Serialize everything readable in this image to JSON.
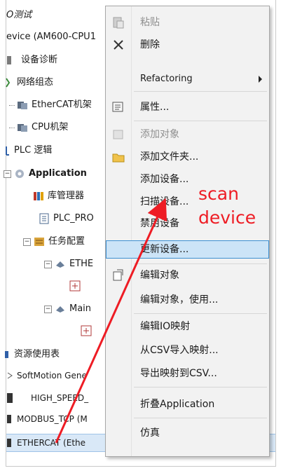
{
  "tree": {
    "root_title": "O测试",
    "device": "evice (AM600-CPU1",
    "items": [
      {
        "label": "设备诊断"
      },
      {
        "label": "网络组态"
      },
      {
        "label": "EtherCAT机架"
      },
      {
        "label": "CPU机架"
      },
      {
        "label": "PLC 逻辑"
      },
      {
        "label": "Application"
      },
      {
        "label": "库管理器"
      },
      {
        "label": "PLC_PRO"
      },
      {
        "label": "任务配置"
      },
      {
        "label": "ETHE"
      },
      {
        "label": "Main"
      },
      {
        "label": "资源使用表"
      },
      {
        "label": "SoftMotion Gene"
      },
      {
        "label": "HIGH_SPEED_"
      },
      {
        "label": "MODBUS_TCP (M"
      },
      {
        "label": "ETHERCAT (Ethe"
      }
    ]
  },
  "context_menu": {
    "items": [
      {
        "label": "粘贴",
        "icon": "paste-icon",
        "enabled": false
      },
      {
        "label": "删除",
        "icon": "delete-icon",
        "enabled": true
      },
      {
        "label": "Refactoring",
        "icon": "",
        "enabled": true,
        "submenu": true
      },
      {
        "label": "属性...",
        "icon": "properties-icon",
        "enabled": true
      },
      {
        "label": "添加对象",
        "icon": "add-object-icon",
        "enabled": false
      },
      {
        "label": "添加文件夹...",
        "icon": "folder-icon",
        "enabled": true
      },
      {
        "label": "添加设备...",
        "icon": "",
        "enabled": true
      },
      {
        "label": "扫描设备...",
        "icon": "",
        "enabled": true
      },
      {
        "label": "禁用设备",
        "icon": "",
        "enabled": true
      },
      {
        "label": "更新设备...",
        "icon": "",
        "enabled": true,
        "highlighted": true
      },
      {
        "label": "编辑对象",
        "icon": "edit-object-icon",
        "enabled": true
      },
      {
        "label": "编辑对象，使用...",
        "icon": "",
        "enabled": true
      },
      {
        "label": "编辑IO映射",
        "icon": "",
        "enabled": true
      },
      {
        "label": "从CSV导入映射...",
        "icon": "",
        "enabled": true
      },
      {
        "label": "导出映射到CSV...",
        "icon": "",
        "enabled": true
      },
      {
        "label": "折叠Application",
        "icon": "",
        "enabled": true
      },
      {
        "label": "仿真",
        "icon": "",
        "enabled": true
      }
    ]
  },
  "annotation": {
    "line1": "scan",
    "line2": "device",
    "color": "#ee1c24"
  }
}
